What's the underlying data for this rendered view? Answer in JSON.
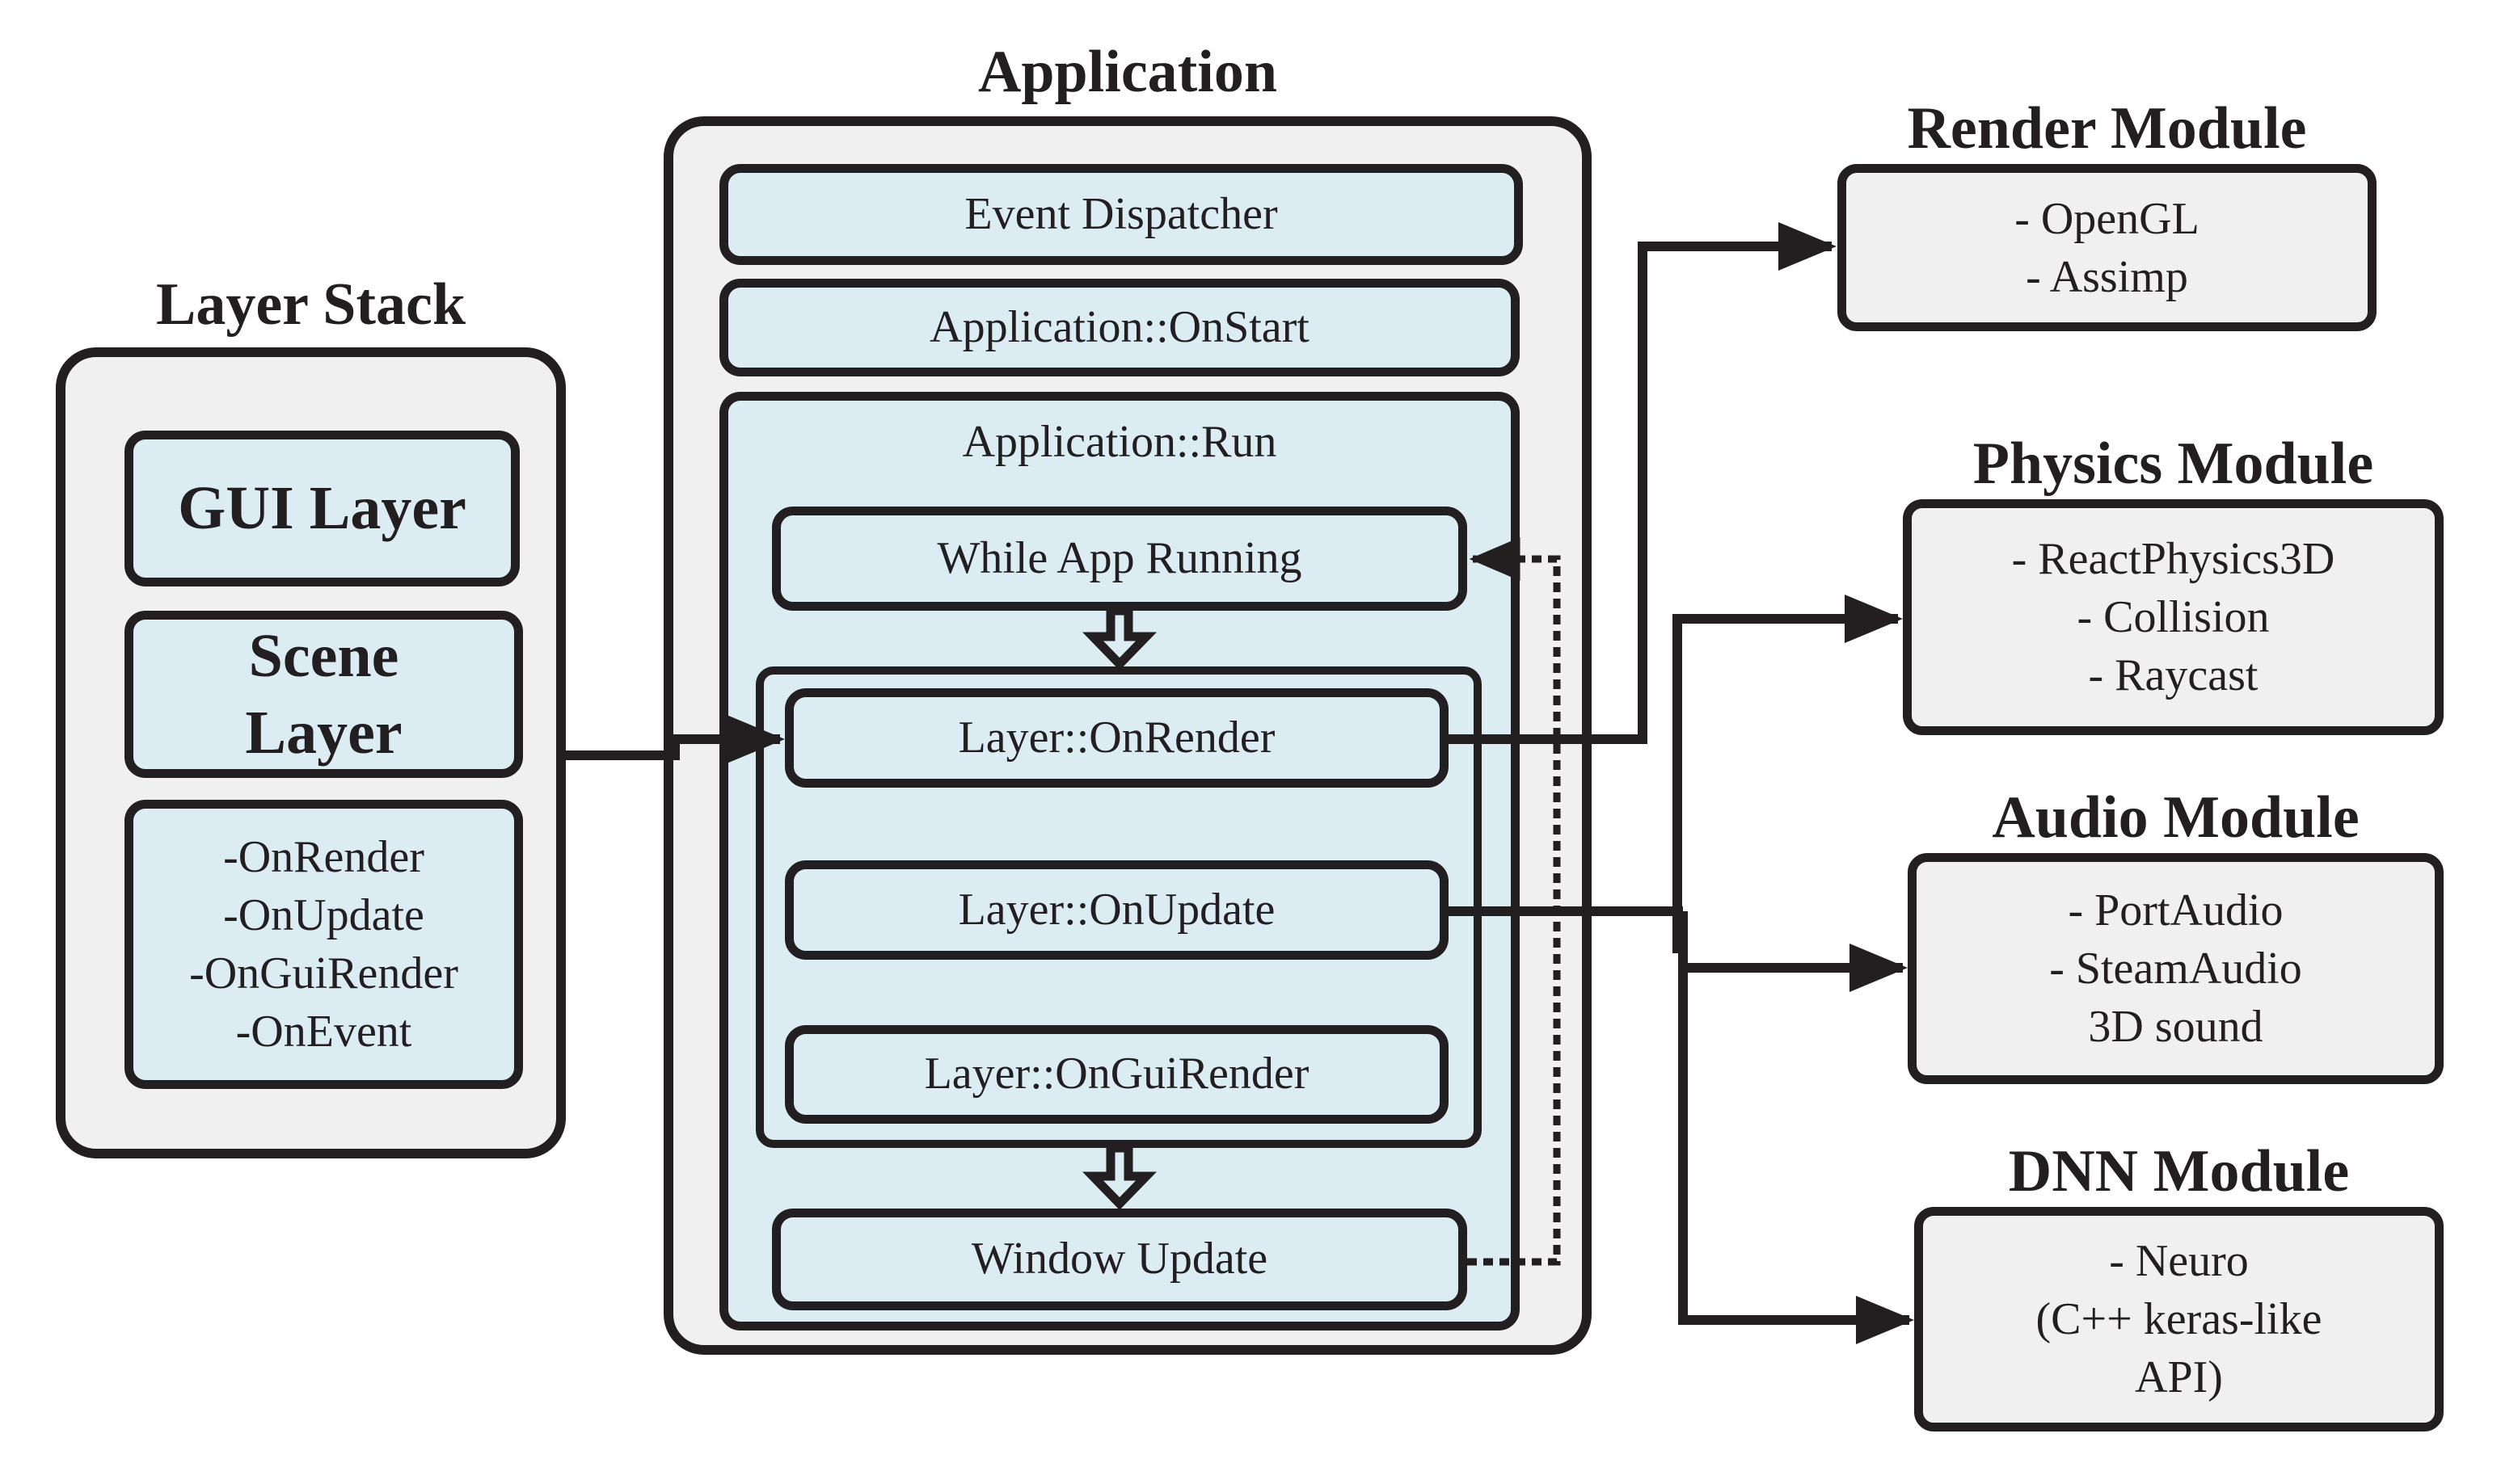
{
  "layer_stack": {
    "title": "Layer Stack",
    "gui_layer": "GUI Layer",
    "scene_layer": [
      "Scene",
      "Layer"
    ],
    "methods": [
      "-OnRender",
      "-OnUpdate",
      "-OnGuiRender",
      "-OnEvent"
    ]
  },
  "application": {
    "title": "Application",
    "event_dispatcher": "Event Dispatcher",
    "on_start": "Application::OnStart",
    "run": {
      "title": "Application::Run",
      "while_running": "While App Running",
      "layer_calls": [
        "Layer::OnRender",
        "Layer::OnUpdate",
        "Layer::OnGuiRender"
      ],
      "window_update": "Window Update"
    }
  },
  "modules": [
    {
      "title": "Render Module",
      "items": [
        "- OpenGL",
        "- Assimp"
      ]
    },
    {
      "title": "Physics Module",
      "items": [
        "- ReactPhysics3D",
        "- Collision",
        "- Raycast"
      ]
    },
    {
      "title": "Audio Module",
      "items": [
        "- PortAudio",
        "- SteamAudio",
        "3D sound"
      ]
    },
    {
      "title": "DNN Module",
      "items": [
        "- Neuro",
        "(C++ keras-like",
        "API)"
      ]
    }
  ],
  "colors": {
    "stroke": "#231f20",
    "container_fill": "#f0f0f0",
    "inner_fill": "#dbedf3"
  }
}
